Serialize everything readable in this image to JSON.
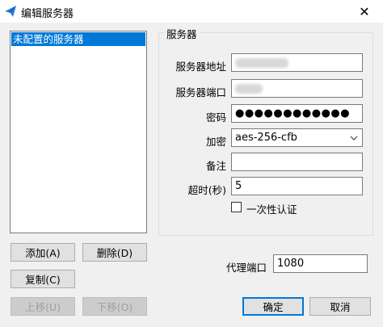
{
  "window": {
    "title": "编辑服务器",
    "close_icon": "✕"
  },
  "server_list": {
    "items": [
      "未配置的服务器"
    ]
  },
  "buttons": {
    "add": "添加(A)",
    "delete": "删除(D)",
    "copy": "复制(C)",
    "move_up": "上移(U)",
    "move_down": "下移(O)",
    "ok": "确定",
    "cancel": "取消"
  },
  "server_group": {
    "title": "服务器",
    "fields": {
      "address_label": "服务器地址",
      "port_label": "服务器端口",
      "password_label": "密码",
      "password_value": "●●●●●●●●●●●●",
      "encryption_label": "加密",
      "encryption_value": "aes-256-cfb",
      "remarks_label": "备注",
      "remarks_value": "",
      "timeout_label": "超时(秒)",
      "timeout_value": "5",
      "one_time_auth_label": "一次性认证"
    }
  },
  "proxy_port": {
    "label": "代理端口",
    "value": "1080"
  },
  "colors": {
    "selection": "#0078d7",
    "accent": "#0078d7"
  }
}
